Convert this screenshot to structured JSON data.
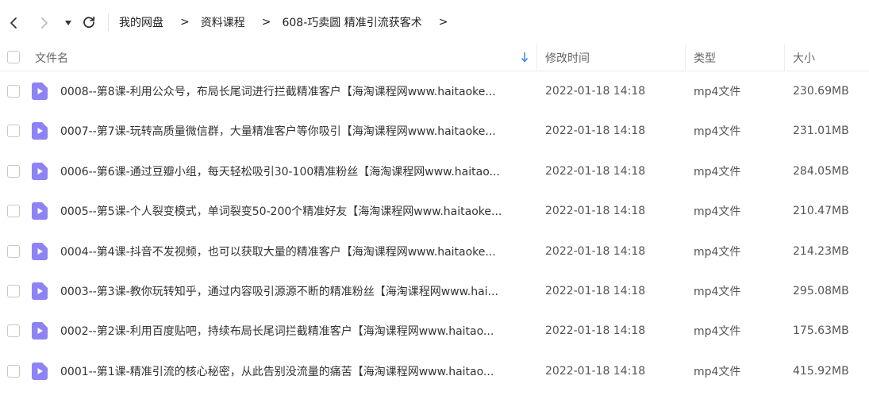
{
  "nav": {
    "back_icon": "chevron-left-icon",
    "forward_icon": "chevron-right-icon",
    "dropdown_icon": "caret-down-icon",
    "refresh_icon": "refresh-icon"
  },
  "breadcrumb": {
    "items": [
      "我的网盘",
      "资料课程",
      "608-巧卖圆 精准引流获客术"
    ],
    "separator": ">"
  },
  "table": {
    "headers": {
      "name": "文件名",
      "modified": "修改时间",
      "type": "类型",
      "size": "大小"
    },
    "sort_icon": "sort-down-arrow-icon",
    "rows": [
      {
        "name": "0008--第8课-利用公众号，布局长尾词进行拦截精准客户【海淘课程网www.haitaoke...",
        "modified": "2022-01-18 14:18",
        "type": "mp4文件",
        "size": "230.69MB"
      },
      {
        "name": "0007--第7课-玩转高质量微信群，大量精准客户等你吸引【海淘课程网www.haitaoke...",
        "modified": "2022-01-18 14:18",
        "type": "mp4文件",
        "size": "231.01MB"
      },
      {
        "name": "0006--第6课-通过豆瓣小组，每天轻松吸引30-100精准粉丝【海淘课程网www.haitao...",
        "modified": "2022-01-18 14:18",
        "type": "mp4文件",
        "size": "284.05MB"
      },
      {
        "name": "0005--第5课-个人裂变模式，单词裂变50-200个精准好友【海淘课程网www.haitaoke...",
        "modified": "2022-01-18 14:18",
        "type": "mp4文件",
        "size": "210.47MB"
      },
      {
        "name": "0004--第4课-抖音不发视频，也可以获取大量的精准客户【海淘课程网www.haitaoke...",
        "modified": "2022-01-18 14:18",
        "type": "mp4文件",
        "size": "214.23MB"
      },
      {
        "name": "0003--第3课-教你玩转知乎，通过内容吸引源源不断的精准粉丝【海淘课程网www.hai...",
        "modified": "2022-01-18 14:18",
        "type": "mp4文件",
        "size": "295.08MB"
      },
      {
        "name": "0002--第2课-利用百度贴吧，持续布局长尾词拦截精准客户【海淘课程网www.haitao...",
        "modified": "2022-01-18 14:18",
        "type": "mp4文件",
        "size": "175.63MB"
      },
      {
        "name": "0001--第1课-精准引流的核心秘密，从此告别没流量的痛苦【海淘课程网www.haitao...",
        "modified": "2022-01-18 14:18",
        "type": "mp4文件",
        "size": "415.92MB"
      }
    ]
  },
  "colors": {
    "video_icon": "#8e83f5",
    "sort_arrow": "#3d8af7",
    "divider": "#ececec"
  }
}
